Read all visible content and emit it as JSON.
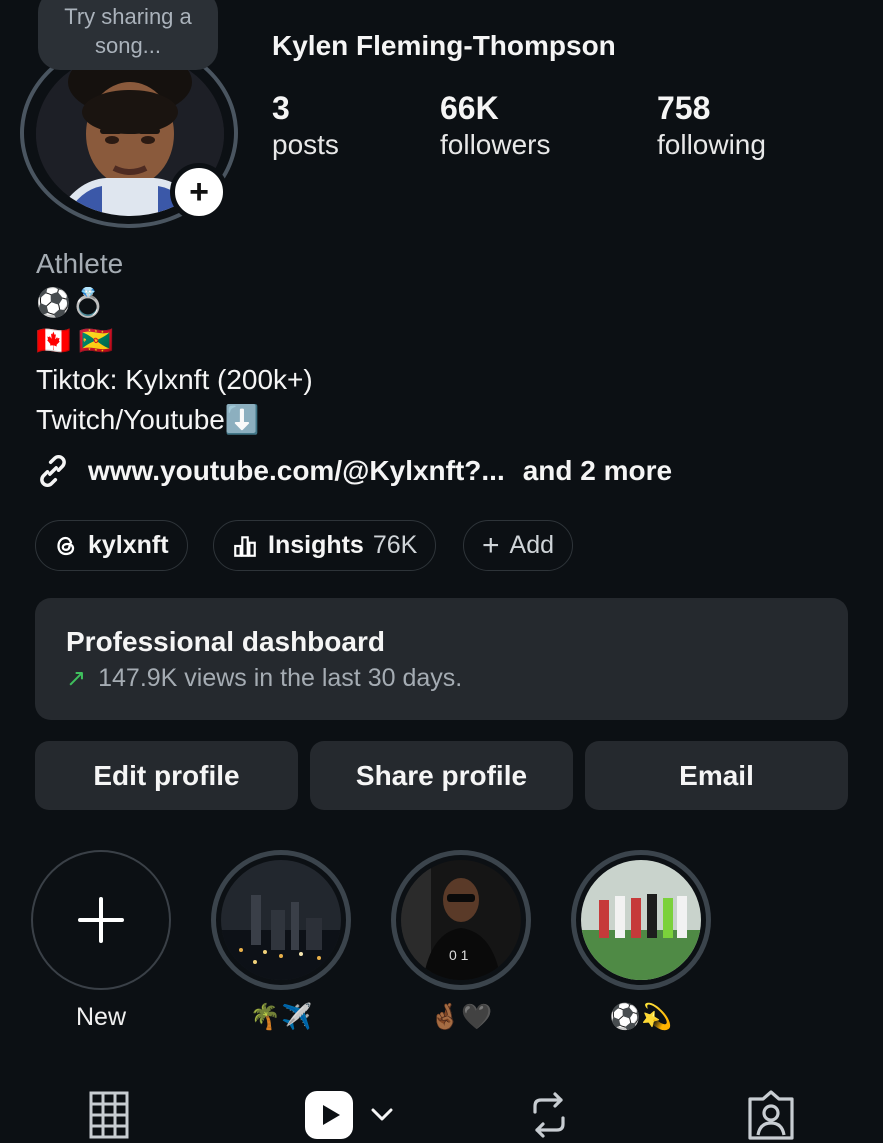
{
  "profile": {
    "note": "Try sharing a song...",
    "username": "Kylen Fleming-Thompson",
    "stats": [
      {
        "value": "3",
        "label": "posts"
      },
      {
        "value": "66K",
        "label": "followers"
      },
      {
        "value": "758",
        "label": "following"
      }
    ]
  },
  "bio": {
    "category": "Athlete",
    "line1": "⚽💍",
    "line2": "🇨🇦 🇬🇩",
    "line3": "Tiktok: Kylxnft (200k+)",
    "line4": "Twitch/Youtube⬇️"
  },
  "links": {
    "primary": "www.youtube.com/@Kylxnft?...",
    "more": "and 2 more"
  },
  "pills": {
    "threads": "kylxnft",
    "insights_label": "Insights",
    "insights_value": "76K",
    "add": "Add"
  },
  "dashboard": {
    "title": "Professional dashboard",
    "subtitle": "147.9K views in the last 30 days.",
    "trend_icon": "↗"
  },
  "buttons": {
    "edit": "Edit profile",
    "share": "Share profile",
    "email": "Email"
  },
  "highlights": [
    {
      "label": "New"
    },
    {
      "label": "🌴✈️"
    },
    {
      "label": "🤞🏾🖤"
    },
    {
      "label": "⚽💫"
    }
  ],
  "colors": {
    "background": "#0c1014",
    "card": "#25292e",
    "trend_green": "#3fbf5d"
  },
  "icons": {
    "tabs": [
      "grid-icon",
      "reels-icon",
      "chevron-down-icon",
      "reposts-icon",
      "tagged-icon"
    ]
  }
}
